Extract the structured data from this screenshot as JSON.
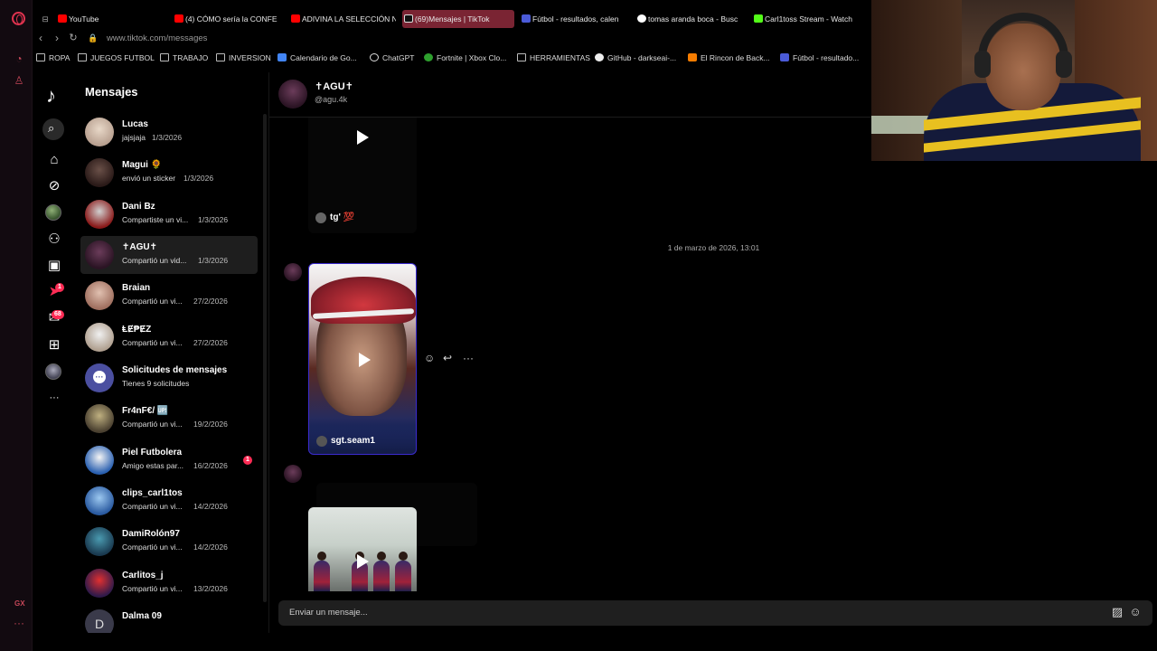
{
  "browser": {
    "gx_label": "GX",
    "tabs": [
      {
        "title": "YouTube",
        "color": "#ff0000"
      },
      {
        "title": "(4) CÓMO sería la CONFE",
        "color": "#ff0000"
      },
      {
        "title": "ADIVINA LA SELECCIÓN N",
        "color": "#ff0000"
      },
      {
        "title": "(69)Mensajes | TikTok",
        "color": "#111111"
      },
      {
        "title": "Fútbol - resultados, calen",
        "color": "#4b5bd8"
      },
      {
        "title": "tomas aranda boca - Busc",
        "color": "#34a853"
      },
      {
        "title": "Carl1toss Stream - Watch",
        "color": "#53fc18"
      }
    ],
    "url": "www.tiktok.com/messages",
    "bookmarks": [
      {
        "label": "ROPA",
        "icon": "folder-icon"
      },
      {
        "label": "JUEGOS FUTBOL",
        "icon": "folder-icon"
      },
      {
        "label": "TRABAJO",
        "icon": "folder-icon"
      },
      {
        "label": "INVERSION",
        "icon": "folder-icon"
      },
      {
        "label": "Calendario de Go...",
        "icon": "calendar-icon"
      },
      {
        "label": "ChatGPT",
        "icon": "chatgpt-icon"
      },
      {
        "label": "Fortnite | Xbox Clo...",
        "icon": "xbox-icon"
      },
      {
        "label": "HERRAMIENTAS",
        "icon": "folder-icon"
      },
      {
        "label": "GitHub - darkseai-...",
        "icon": "github-icon"
      },
      {
        "label": "El Rincon de Back...",
        "icon": "blogger-icon"
      },
      {
        "label": "Fútbol - resultado...",
        "icon": "flashscore-icon"
      }
    ]
  },
  "tiktok": {
    "rail_badges": {
      "activity": "1",
      "messages": "68"
    },
    "sidebar_title": "Mensajes",
    "conversations": [
      {
        "name": "Lucas",
        "preview": "jajsjaja",
        "date": "1/3/2026"
      },
      {
        "name": "Magui 🌻",
        "preview": "envió un sticker",
        "date": "1/3/2026"
      },
      {
        "name": "Dani Bz",
        "preview": "Compartiste un vi...",
        "date": "1/3/2026"
      },
      {
        "name": "✝AGU✝",
        "preview": "Compartió un vid...",
        "date": "1/3/2026"
      },
      {
        "name": "Braian",
        "preview": "Compartió un vi...",
        "date": "27/2/2026"
      },
      {
        "name": "ⱠɆ₱ɆZ",
        "preview": "Compartió un vi...",
        "date": "27/2/2026"
      },
      {
        "name": "Solicitudes de mensajes",
        "preview": "Tienes 9 solicitudes",
        "date": ""
      },
      {
        "name": "Fr4nF€/ 🆙",
        "preview": "Compartió un vi...",
        "date": "19/2/2026"
      },
      {
        "name": "Piel Futbolera",
        "preview": "Amigo estas par...",
        "date": "16/2/2026",
        "badge": "1"
      },
      {
        "name": "clips_carl1tos",
        "preview": "Compartió un vi...",
        "date": "14/2/2026"
      },
      {
        "name": "DamiRolón97",
        "preview": "Compartió un vi...",
        "date": "14/2/2026"
      },
      {
        "name": "Carlitos_j",
        "preview": "Compartió un vi...",
        "date": "13/2/2026"
      },
      {
        "name": "Dalma 09",
        "preview": "",
        "date": "",
        "avatar_letter": "D"
      }
    ],
    "chat": {
      "name": "✝AGU✝",
      "handle": "@agu.4k",
      "first_video_caption": "tg' 💯",
      "timestamp": "1 de marzo de 2026, 13:01",
      "second_video_caption": "sgt.seam1",
      "composer_placeholder": "Enviar un mensaje..."
    }
  }
}
